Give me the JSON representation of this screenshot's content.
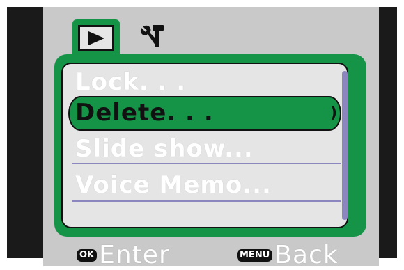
{
  "tabs": [
    {
      "name": "playback",
      "icon": "play-icon",
      "selected": true
    },
    {
      "name": "settings",
      "icon": "tools-icon",
      "selected": false
    }
  ],
  "menu": {
    "items": [
      {
        "label": "Lock. . ."
      },
      {
        "label": "Delete. . ."
      },
      {
        "label": "Slide show..."
      },
      {
        "label": "Voice Memo..."
      }
    ],
    "selected_index": 1
  },
  "footer": {
    "ok_key": "OK",
    "ok_label": "Enter",
    "menu_key": "MENU",
    "menu_label": "Back"
  },
  "colors": {
    "accent": "#159447",
    "lcd_background": "#c9c9c9",
    "list_background": "#e5e5e5",
    "separator": "#8c86bf",
    "text": "#ffffff"
  }
}
